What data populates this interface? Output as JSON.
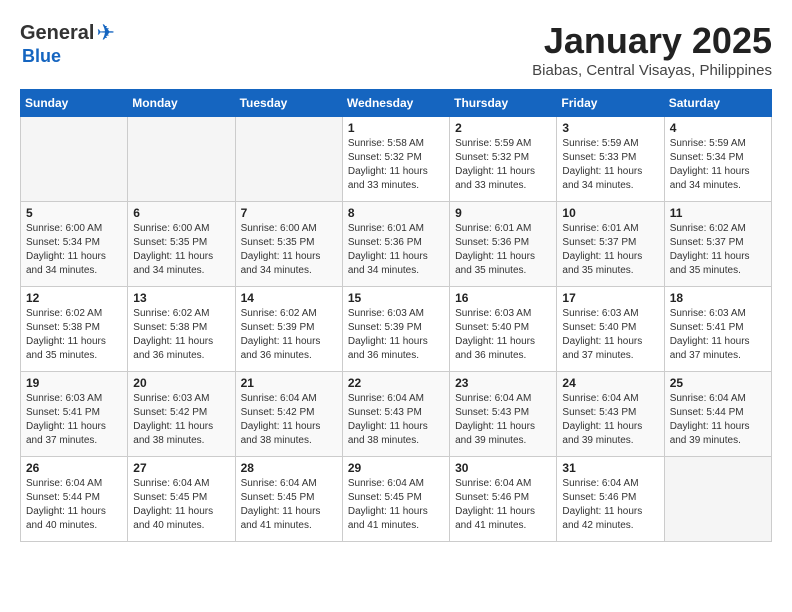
{
  "logo": {
    "general": "General",
    "blue": "Blue"
  },
  "header": {
    "month": "January 2025",
    "location": "Biabas, Central Visayas, Philippines"
  },
  "weekdays": [
    "Sunday",
    "Monday",
    "Tuesday",
    "Wednesday",
    "Thursday",
    "Friday",
    "Saturday"
  ],
  "weeks": [
    [
      {
        "day": "",
        "empty": true
      },
      {
        "day": "",
        "empty": true
      },
      {
        "day": "",
        "empty": true
      },
      {
        "day": "1",
        "sunrise": "5:58 AM",
        "sunset": "5:32 PM",
        "daylight": "11 hours and 33 minutes."
      },
      {
        "day": "2",
        "sunrise": "5:59 AM",
        "sunset": "5:32 PM",
        "daylight": "11 hours and 33 minutes."
      },
      {
        "day": "3",
        "sunrise": "5:59 AM",
        "sunset": "5:33 PM",
        "daylight": "11 hours and 34 minutes."
      },
      {
        "day": "4",
        "sunrise": "5:59 AM",
        "sunset": "5:34 PM",
        "daylight": "11 hours and 34 minutes."
      }
    ],
    [
      {
        "day": "5",
        "sunrise": "6:00 AM",
        "sunset": "5:34 PM",
        "daylight": "11 hours and 34 minutes."
      },
      {
        "day": "6",
        "sunrise": "6:00 AM",
        "sunset": "5:35 PM",
        "daylight": "11 hours and 34 minutes."
      },
      {
        "day": "7",
        "sunrise": "6:00 AM",
        "sunset": "5:35 PM",
        "daylight": "11 hours and 34 minutes."
      },
      {
        "day": "8",
        "sunrise": "6:01 AM",
        "sunset": "5:36 PM",
        "daylight": "11 hours and 34 minutes."
      },
      {
        "day": "9",
        "sunrise": "6:01 AM",
        "sunset": "5:36 PM",
        "daylight": "11 hours and 35 minutes."
      },
      {
        "day": "10",
        "sunrise": "6:01 AM",
        "sunset": "5:37 PM",
        "daylight": "11 hours and 35 minutes."
      },
      {
        "day": "11",
        "sunrise": "6:02 AM",
        "sunset": "5:37 PM",
        "daylight": "11 hours and 35 minutes."
      }
    ],
    [
      {
        "day": "12",
        "sunrise": "6:02 AM",
        "sunset": "5:38 PM",
        "daylight": "11 hours and 35 minutes."
      },
      {
        "day": "13",
        "sunrise": "6:02 AM",
        "sunset": "5:38 PM",
        "daylight": "11 hours and 36 minutes."
      },
      {
        "day": "14",
        "sunrise": "6:02 AM",
        "sunset": "5:39 PM",
        "daylight": "11 hours and 36 minutes."
      },
      {
        "day": "15",
        "sunrise": "6:03 AM",
        "sunset": "5:39 PM",
        "daylight": "11 hours and 36 minutes."
      },
      {
        "day": "16",
        "sunrise": "6:03 AM",
        "sunset": "5:40 PM",
        "daylight": "11 hours and 36 minutes."
      },
      {
        "day": "17",
        "sunrise": "6:03 AM",
        "sunset": "5:40 PM",
        "daylight": "11 hours and 37 minutes."
      },
      {
        "day": "18",
        "sunrise": "6:03 AM",
        "sunset": "5:41 PM",
        "daylight": "11 hours and 37 minutes."
      }
    ],
    [
      {
        "day": "19",
        "sunrise": "6:03 AM",
        "sunset": "5:41 PM",
        "daylight": "11 hours and 37 minutes."
      },
      {
        "day": "20",
        "sunrise": "6:03 AM",
        "sunset": "5:42 PM",
        "daylight": "11 hours and 38 minutes."
      },
      {
        "day": "21",
        "sunrise": "6:04 AM",
        "sunset": "5:42 PM",
        "daylight": "11 hours and 38 minutes."
      },
      {
        "day": "22",
        "sunrise": "6:04 AM",
        "sunset": "5:43 PM",
        "daylight": "11 hours and 38 minutes."
      },
      {
        "day": "23",
        "sunrise": "6:04 AM",
        "sunset": "5:43 PM",
        "daylight": "11 hours and 39 minutes."
      },
      {
        "day": "24",
        "sunrise": "6:04 AM",
        "sunset": "5:43 PM",
        "daylight": "11 hours and 39 minutes."
      },
      {
        "day": "25",
        "sunrise": "6:04 AM",
        "sunset": "5:44 PM",
        "daylight": "11 hours and 39 minutes."
      }
    ],
    [
      {
        "day": "26",
        "sunrise": "6:04 AM",
        "sunset": "5:44 PM",
        "daylight": "11 hours and 40 minutes."
      },
      {
        "day": "27",
        "sunrise": "6:04 AM",
        "sunset": "5:45 PM",
        "daylight": "11 hours and 40 minutes."
      },
      {
        "day": "28",
        "sunrise": "6:04 AM",
        "sunset": "5:45 PM",
        "daylight": "11 hours and 41 minutes."
      },
      {
        "day": "29",
        "sunrise": "6:04 AM",
        "sunset": "5:45 PM",
        "daylight": "11 hours and 41 minutes."
      },
      {
        "day": "30",
        "sunrise": "6:04 AM",
        "sunset": "5:46 PM",
        "daylight": "11 hours and 41 minutes."
      },
      {
        "day": "31",
        "sunrise": "6:04 AM",
        "sunset": "5:46 PM",
        "daylight": "11 hours and 42 minutes."
      },
      {
        "day": "",
        "empty": true
      }
    ]
  ]
}
